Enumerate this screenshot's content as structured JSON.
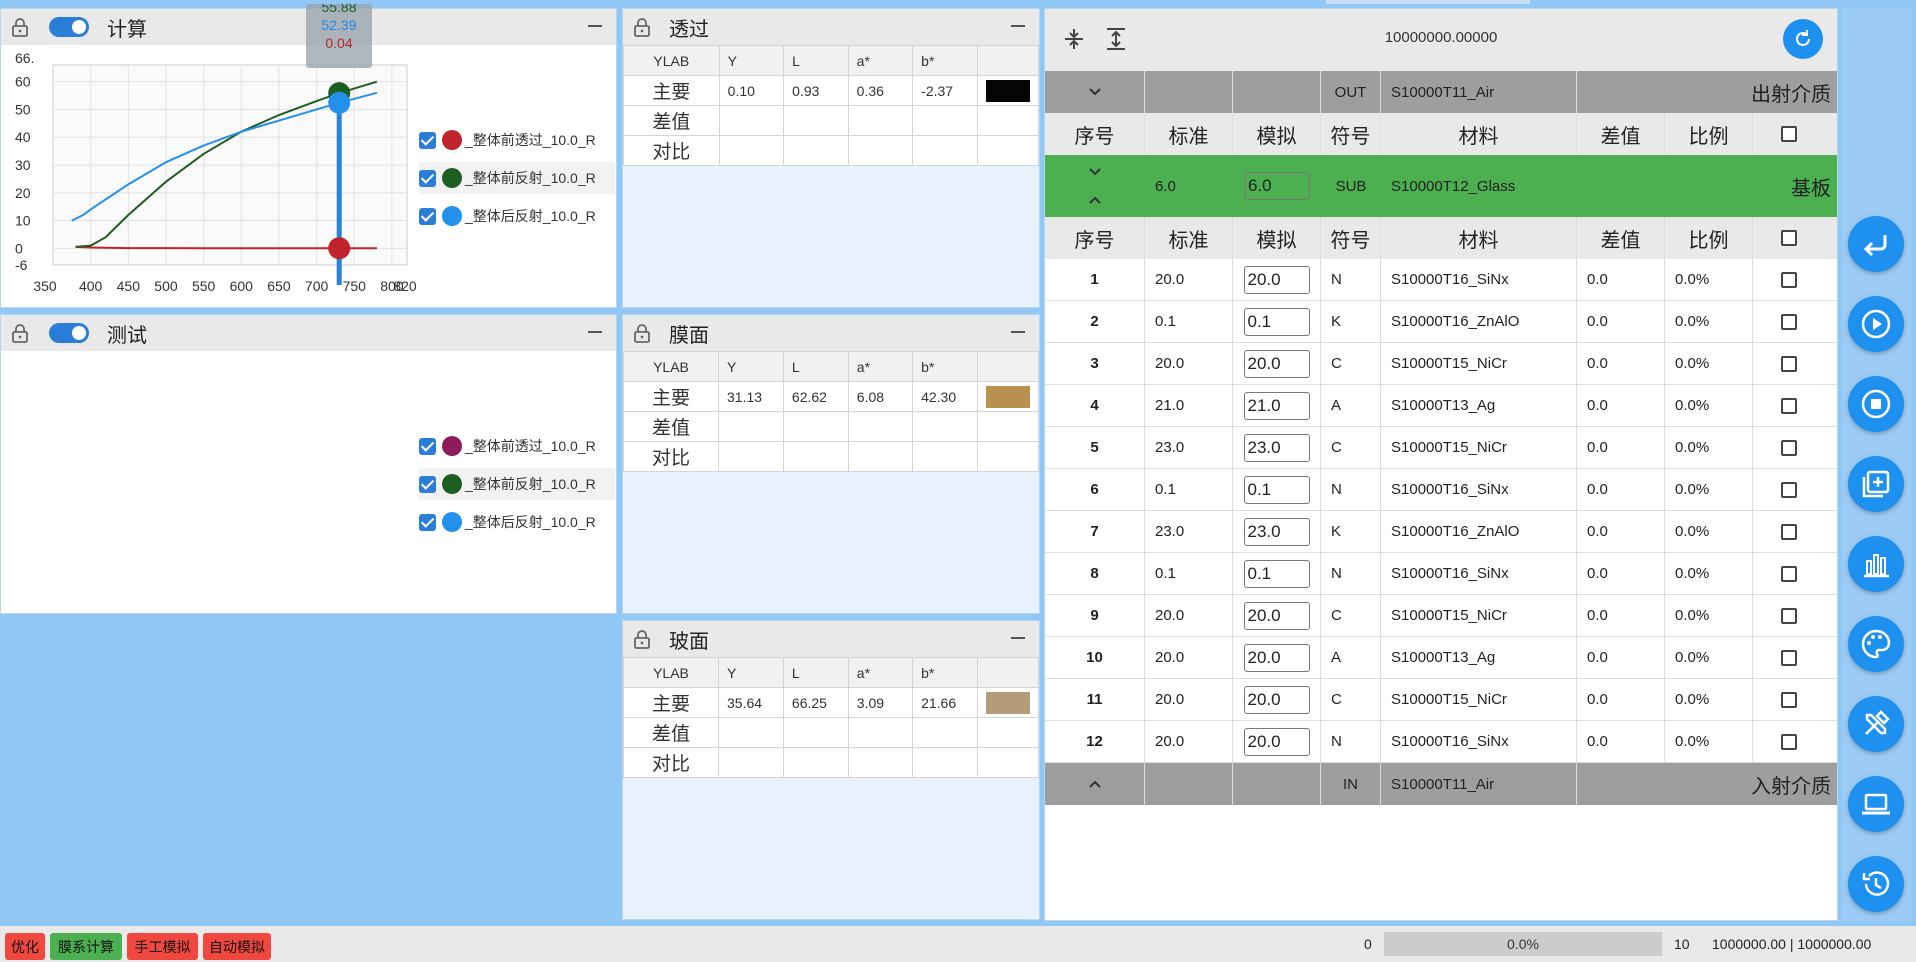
{
  "panels": {
    "calc": {
      "title": "计算"
    },
    "test": {
      "title": "测试"
    },
    "transmit": {
      "title": "透过"
    },
    "film": {
      "title": "膜面"
    },
    "glass": {
      "title": "玻面"
    }
  },
  "tooltip": {
    "v1": "55.88",
    "v2": "52.39",
    "v3": "0.04"
  },
  "chart_data": {
    "type": "line",
    "xlim": [
      350,
      820
    ],
    "ylim": [
      -6,
      66
    ],
    "x_ticks": [
      "350",
      "400",
      "450",
      "500",
      "550",
      "600",
      "650",
      "700",
      "750",
      "800",
      "820"
    ],
    "y_ticks": [
      "66.",
      "60",
      "50",
      "40",
      "30",
      "20",
      "10",
      "0",
      "-6"
    ],
    "cursor_x": 730,
    "grid": true,
    "series": [
      {
        "name": "_整体前透过_10.0_R",
        "color": "#c0232b",
        "x": [
          380,
          400,
          450,
          500,
          550,
          600,
          650,
          700,
          730,
          780
        ],
        "y": [
          0.5,
          0.3,
          0.1,
          0.1,
          0.05,
          0.05,
          0.04,
          0.04,
          0.04,
          0.04
        ]
      },
      {
        "name": "_整体前反射_10.0_R",
        "color": "#1d5e22",
        "x": [
          380,
          400,
          420,
          450,
          500,
          550,
          600,
          650,
          700,
          730,
          780
        ],
        "y": [
          0.5,
          1,
          4,
          12,
          24,
          34,
          42,
          48,
          53,
          55.88,
          60
        ]
      },
      {
        "name": "_整体后反射_10.0_R",
        "color": "#2391ec",
        "x": [
          375,
          390,
          400,
          450,
          500,
          550,
          600,
          650,
          700,
          730,
          780
        ],
        "y": [
          10,
          12,
          14,
          23,
          31,
          37,
          42,
          46,
          50,
          52.39,
          56
        ]
      }
    ]
  },
  "legend_calc": [
    {
      "label": "_整体前透过_10.0_R",
      "color": "#c0232b"
    },
    {
      "label": "_整体前反射_10.0_R",
      "color": "#1d5e22"
    },
    {
      "label": "_整体后反射_10.0_R",
      "color": "#2391ec"
    }
  ],
  "legend_test": [
    {
      "label": "_整体前透过_10.0_R",
      "color": "#8e1b5c"
    },
    {
      "label": "_整体前反射_10.0_R",
      "color": "#1d5e22"
    },
    {
      "label": "_整体后反射_10.0_R",
      "color": "#2391ec"
    }
  ],
  "ylab": {
    "headers": [
      "YLAB",
      "Y",
      "L",
      "a*",
      "b*"
    ],
    "row_labels": [
      "主要",
      "差值",
      "对比"
    ],
    "transmit": {
      "main": [
        "0.10",
        "0.93",
        "0.36",
        "-2.37"
      ],
      "swatch": "#050505"
    },
    "film": {
      "main": [
        "31.13",
        "62.62",
        "6.08",
        "42.30"
      ],
      "swatch": "#b8914e"
    },
    "glass": {
      "main": [
        "35.64",
        "66.25",
        "3.09",
        "21.66"
      ],
      "swatch": "#b59c78"
    }
  },
  "layers": {
    "toolbar_value": "10000000.00000",
    "out_row": {
      "sym": "OUT",
      "material": "S10000T11_Air",
      "label": "出射介质"
    },
    "headers": [
      "序号",
      "标准",
      "模拟",
      "符号",
      "材料",
      "差值",
      "比例"
    ],
    "sub_row": {
      "std": "6.0",
      "sim": "6.0",
      "sym": "SUB",
      "material": "S10000T12_Glass",
      "label": "基板",
      "color": "#4caf50"
    },
    "rows": [
      {
        "n": "1",
        "std": "20.0",
        "sim": "20.0",
        "sym": "N",
        "mat": "S10000T16_SiNx",
        "diff": "0.0",
        "ratio": "0.0%"
      },
      {
        "n": "2",
        "std": "0.1",
        "sim": "0.1",
        "sym": "K",
        "mat": "S10000T16_ZnAlO",
        "diff": "0.0",
        "ratio": "0.0%"
      },
      {
        "n": "3",
        "std": "20.0",
        "sim": "20.0",
        "sym": "C",
        "mat": "S10000T15_NiCr",
        "diff": "0.0",
        "ratio": "0.0%"
      },
      {
        "n": "4",
        "std": "21.0",
        "sim": "21.0",
        "sym": "A",
        "mat": "S10000T13_Ag",
        "diff": "0.0",
        "ratio": "0.0%"
      },
      {
        "n": "5",
        "std": "23.0",
        "sim": "23.0",
        "sym": "C",
        "mat": "S10000T15_NiCr",
        "diff": "0.0",
        "ratio": "0.0%"
      },
      {
        "n": "6",
        "std": "0.1",
        "sim": "0.1",
        "sym": "N",
        "mat": "S10000T16_SiNx",
        "diff": "0.0",
        "ratio": "0.0%"
      },
      {
        "n": "7",
        "std": "23.0",
        "sim": "23.0",
        "sym": "K",
        "mat": "S10000T16_ZnAlO",
        "diff": "0.0",
        "ratio": "0.0%"
      },
      {
        "n": "8",
        "std": "0.1",
        "sim": "0.1",
        "sym": "N",
        "mat": "S10000T16_SiNx",
        "diff": "0.0",
        "ratio": "0.0%"
      },
      {
        "n": "9",
        "std": "20.0",
        "sim": "20.0",
        "sym": "C",
        "mat": "S10000T15_NiCr",
        "diff": "0.0",
        "ratio": "0.0%"
      },
      {
        "n": "10",
        "std": "20.0",
        "sim": "20.0",
        "sym": "A",
        "mat": "S10000T13_Ag",
        "diff": "0.0",
        "ratio": "0.0%"
      },
      {
        "n": "11",
        "std": "20.0",
        "sim": "20.0",
        "sym": "C",
        "mat": "S10000T15_NiCr",
        "diff": "0.0",
        "ratio": "0.0%"
      },
      {
        "n": "12",
        "std": "20.0",
        "sim": "20.0",
        "sym": "N",
        "mat": "S10000T16_SiNx",
        "diff": "0.0",
        "ratio": "0.0%"
      }
    ],
    "in_row": {
      "sym": "IN",
      "material": "S10000T11_Air",
      "label": "入射介质"
    }
  },
  "side_icons": [
    "enter-icon",
    "play-icon",
    "stop-icon",
    "add-layer-icon",
    "bar-chart-icon",
    "palette-icon",
    "tools-icon",
    "laptop-icon",
    "history-icon"
  ],
  "status": {
    "buttons": [
      {
        "label": "优化",
        "color": "#f0483e"
      },
      {
        "label": "膜系计算",
        "color": "#4caf50"
      },
      {
        "label": "手工模拟",
        "color": "#f0483e"
      },
      {
        "label": "自动模拟",
        "color": "#f0483e"
      }
    ],
    "progress_min": "0",
    "progress_text": "0.0%",
    "progress_value": 0,
    "progress_max": "10",
    "right_text": "1000000.00 | 1000000.00"
  }
}
